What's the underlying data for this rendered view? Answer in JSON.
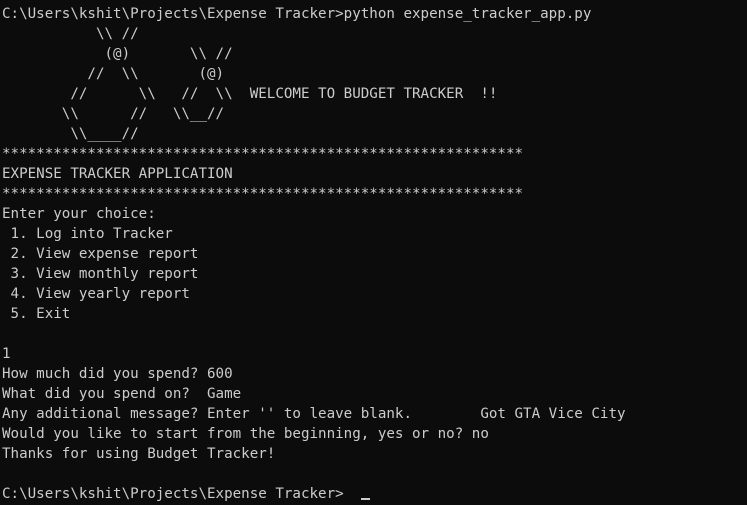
{
  "terminal": {
    "prompt_command": "C:\\Users\\kshit\\Projects\\Expense Tracker>python expense_tracker_app.py",
    "art": [
      "           \\\\ //",
      "            (@)       \\\\ //",
      "          //  \\\\       (@)",
      "        //      \\\\   //  \\\\  WELCOME TO BUDGET TRACKER  !!",
      "       \\\\      //   \\\\__//",
      "        \\\\____//"
    ],
    "separator_top": "*************************************************************",
    "app_title": "EXPENSE TRACKER APPLICATION",
    "separator_bottom": "*************************************************************",
    "menu_prompt": "Enter your choice:",
    "menu_items": [
      " 1. Log into Tracker",
      " 2. View expense report",
      " 3. View monthly report",
      " 4. View yearly report",
      " 5. Exit"
    ],
    "session": [
      "1",
      "How much did you spend? 600",
      "What did you spend on?  Game",
      "Any additional message? Enter '' to leave blank.        Got GTA Vice City",
      "Would you like to start from the beginning, yes or no? no",
      "Thanks for using Budget Tracker!"
    ],
    "final_prompt": "C:\\Users\\kshit\\Projects\\Expense Tracker>"
  }
}
